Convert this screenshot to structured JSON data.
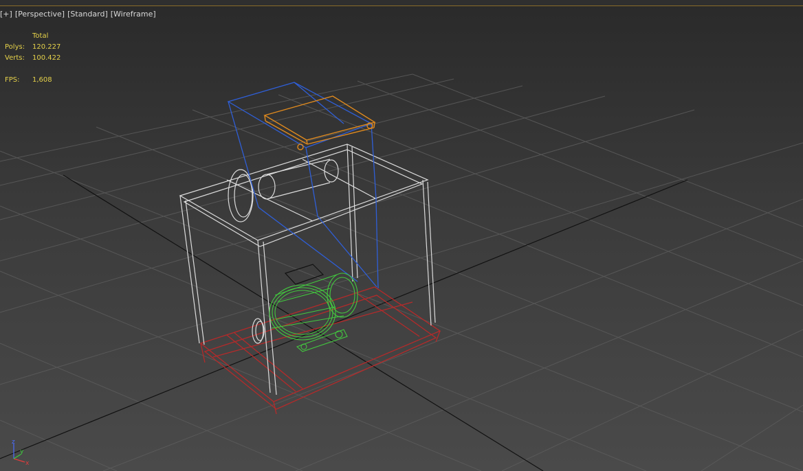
{
  "viewport": {
    "menu_label": "[+]",
    "view_label": "[Perspective]",
    "shading_label": "[Standard]",
    "display_label": "[Wireframe]"
  },
  "stats": {
    "header": "Total",
    "polys_label": "Polys:",
    "polys_value": "120.227",
    "verts_label": "Verts:",
    "verts_value": "100.422",
    "fps_label": "FPS:",
    "fps_value": "1,608"
  },
  "gizmo": {
    "z_label": "z",
    "x_label": "x",
    "y_label": "y"
  },
  "colors": {
    "frame_white": "#d9d9d9",
    "hopper_blue": "#2f5fd8",
    "lid_orange": "#e08a1e",
    "base_red": "#b52a2a",
    "motor_green": "#43c93f",
    "grid_line": "#5a5a5a",
    "grid_axis": "#111111",
    "stats_text": "#e6d24a"
  }
}
